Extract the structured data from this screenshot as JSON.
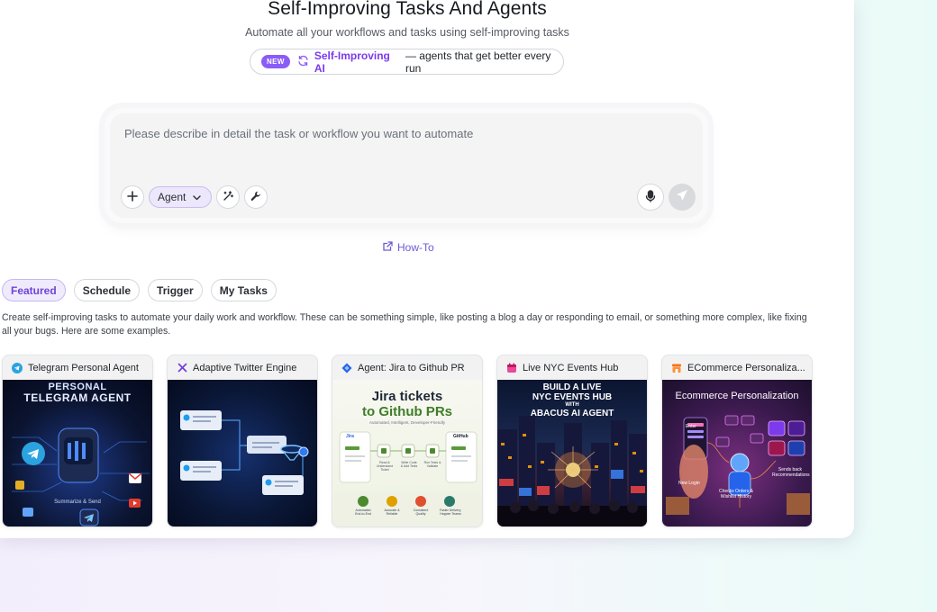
{
  "header": {
    "title": "Self-Improving Tasks And Agents",
    "subtitle": "Automate all your workflows and tasks using self-improving tasks",
    "pill": {
      "badge": "NEW",
      "strong": "Self-Improving AI",
      "rest": "— agents that get better every run",
      "icon": "refresh-icon"
    }
  },
  "composer": {
    "placeholder": "Please describe in detail the task or workflow you want to automate",
    "agent_label": "Agent",
    "icons": [
      "plus-icon",
      "chevron-down-icon",
      "magic-wand-icon",
      "wrench-icon",
      "microphone-icon",
      "send-icon"
    ]
  },
  "howto": {
    "label": "How-To",
    "icon": "external-link-icon"
  },
  "tabs": [
    {
      "label": "Featured",
      "active": true
    },
    {
      "label": "Schedule",
      "active": false
    },
    {
      "label": "Trigger",
      "active": false
    },
    {
      "label": "My Tasks",
      "active": false
    }
  ],
  "description": "Create self-improving tasks to automate your daily work and workflow. These can be something simple, like posting a blog a day or responding to email, or something more complex, like fixing all your bugs. Here are some examples.",
  "cards": [
    {
      "title": "Telegram Personal Agent",
      "icon": "telegram-icon",
      "art": {
        "line1": "PERSONAL",
        "line2": "TELEGRAM AGENT",
        "caption": "Summarize & Send"
      }
    },
    {
      "title": "Adaptive Twitter Engine",
      "icon": "x-logo-icon",
      "art": {}
    },
    {
      "title": "Agent: Jira to Github PR",
      "icon": "jira-icon",
      "art": {
        "line1": "Jira tickets",
        "line2": "to Github PRs",
        "tagline": "Automated, Intelligent, Developer-Friendly",
        "left_label": "Jira",
        "right_label": "GitHub",
        "steps": [
          "Read & Understand Ticket",
          "Write Code & Add Tests",
          "Run Tests & Validate"
        ],
        "features": [
          "Automated End-to-End",
          "Accurate & Reliable",
          "Consistent Quality",
          "Faster Delivery, Happier Teams"
        ]
      }
    },
    {
      "title": "Live NYC Events Hub",
      "icon": "calendar-icon",
      "art": {
        "line1": "BUILD A LIVE",
        "line2": "NYC EVENTS HUB",
        "line3": "WITH",
        "line4": "ABACUS AI AGENT"
      }
    },
    {
      "title": "ECommerce Personaliza...",
      "icon": "store-icon",
      "art": {
        "line1": "Ecommerce Personalization",
        "enter": "Enter",
        "new_login": "New Login",
        "recs": "Sends back Recommendations",
        "history": "Checks Orders & Wishlist History"
      }
    }
  ]
}
